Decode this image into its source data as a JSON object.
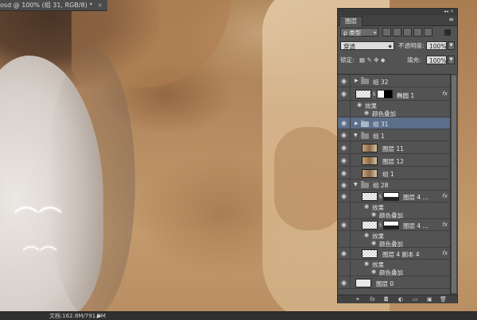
{
  "document": {
    "tab_title": "osd @ 100% (组 31, RGB/8) *",
    "close_glyph": "×"
  },
  "status": {
    "doc_size": "文档:162.8M/791.9M",
    "arrow": "▶"
  },
  "panel": {
    "top_collapse": "◂◂ ×",
    "tab": "图层",
    "menu_glyph": "≡",
    "filter_kind": "ρ 类型",
    "blend_mode": "穿透",
    "opacity_label": "不透明度:",
    "opacity_value": "100%",
    "lock_label": "锁定:",
    "fill_label": "填充:",
    "fill_value": "100%",
    "lock_icons": "▦ ✎ ✥ ◆",
    "bottom_icons": [
      "⚭",
      "fx",
      "◘",
      "◐",
      "▭",
      "▣",
      "🗑"
    ]
  },
  "layers": [
    {
      "kind": "group",
      "name": "组 32",
      "expanded": false
    },
    {
      "kind": "layer",
      "name": "椭圆 1",
      "fx": "fx",
      "thumb": "checker",
      "mask": "split"
    },
    {
      "kind": "sub",
      "name": "效果"
    },
    {
      "kind": "sub2",
      "name": "颜色叠加"
    },
    {
      "kind": "group",
      "name": "组 31",
      "expanded": false,
      "selected": true
    },
    {
      "kind": "group",
      "name": "组 1",
      "expanded": true
    },
    {
      "kind": "layer",
      "name": "图层 11",
      "thumb": "photo"
    },
    {
      "kind": "layer",
      "name": "图层 12",
      "thumb": "photo"
    },
    {
      "kind": "layer",
      "name": "组 1",
      "thumb": "photo"
    },
    {
      "kind": "group",
      "name": "组 28",
      "expanded": true
    },
    {
      "kind": "layer",
      "name": "图层 4 ...",
      "fx": "fx",
      "thumb": "checker",
      "mask": "land"
    },
    {
      "kind": "sub",
      "name": "效果"
    },
    {
      "kind": "sub2",
      "name": "颜色叠加"
    },
    {
      "kind": "layer",
      "name": "图层 4 ...",
      "fx": "fx",
      "thumb": "checker",
      "mask": "land"
    },
    {
      "kind": "sub",
      "name": "效果"
    },
    {
      "kind": "sub2",
      "name": "颜色叠加"
    },
    {
      "kind": "layer",
      "name": "图层 4 副本 4",
      "fx": "fx",
      "thumb": "checker"
    },
    {
      "kind": "sub",
      "name": "效果"
    },
    {
      "kind": "sub2",
      "name": "颜色叠加"
    },
    {
      "kind": "layer",
      "name": "图层 0",
      "thumb": "gray"
    }
  ]
}
